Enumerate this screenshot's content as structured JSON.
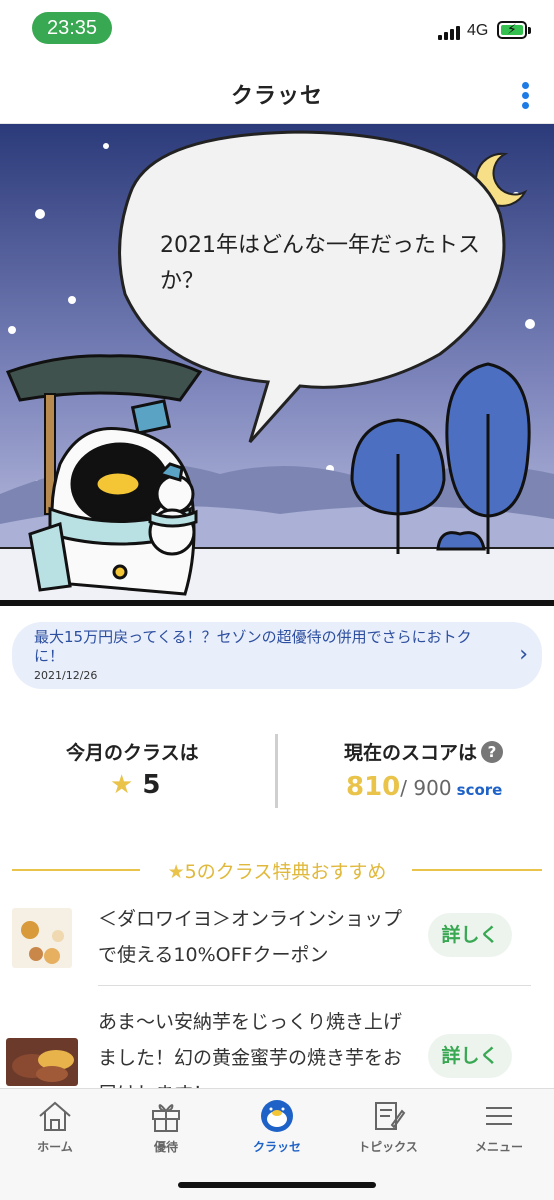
{
  "status_bar": {
    "time": "23:35",
    "network": "4G"
  },
  "header": {
    "title": "クラッセ"
  },
  "hero": {
    "speech_text": "2021年はどんな一年だったトスか？"
  },
  "banner": {
    "text": "最大15万円戻ってくる！？セゾンの超優待の併用でさらにおトクに！",
    "date": "2021/12/26"
  },
  "stats": {
    "class_label": "今月のクラスは",
    "class_value": "5",
    "score_label": "現在のスコアは",
    "score_value": "810",
    "score_max": "/ 900",
    "score_unit": "score"
  },
  "perks": {
    "heading": "5のクラス特典おすすめ",
    "items": [
      {
        "text": "＜ダロワイヨ＞オンラインショップで使える10%OFFクーポン",
        "button": "詳しく"
      },
      {
        "text": "あま〜い安納芋をじっくり焼き上げました！幻の黄金蜜芋の焼き芋をお届けします！",
        "button": "詳しく"
      }
    ]
  },
  "tabbar": {
    "tabs": [
      {
        "label": "ホーム",
        "icon": "home-icon"
      },
      {
        "label": "優待",
        "icon": "gift-icon"
      },
      {
        "label": "クラッセ",
        "icon": "penguin-icon"
      },
      {
        "label": "トピックス",
        "icon": "notepad-icon"
      },
      {
        "label": "メニュー",
        "icon": "menu-icon"
      }
    ]
  },
  "colors": {
    "accent_blue": "#1e62c8",
    "gold": "#e9c34a",
    "green": "#39a852"
  }
}
